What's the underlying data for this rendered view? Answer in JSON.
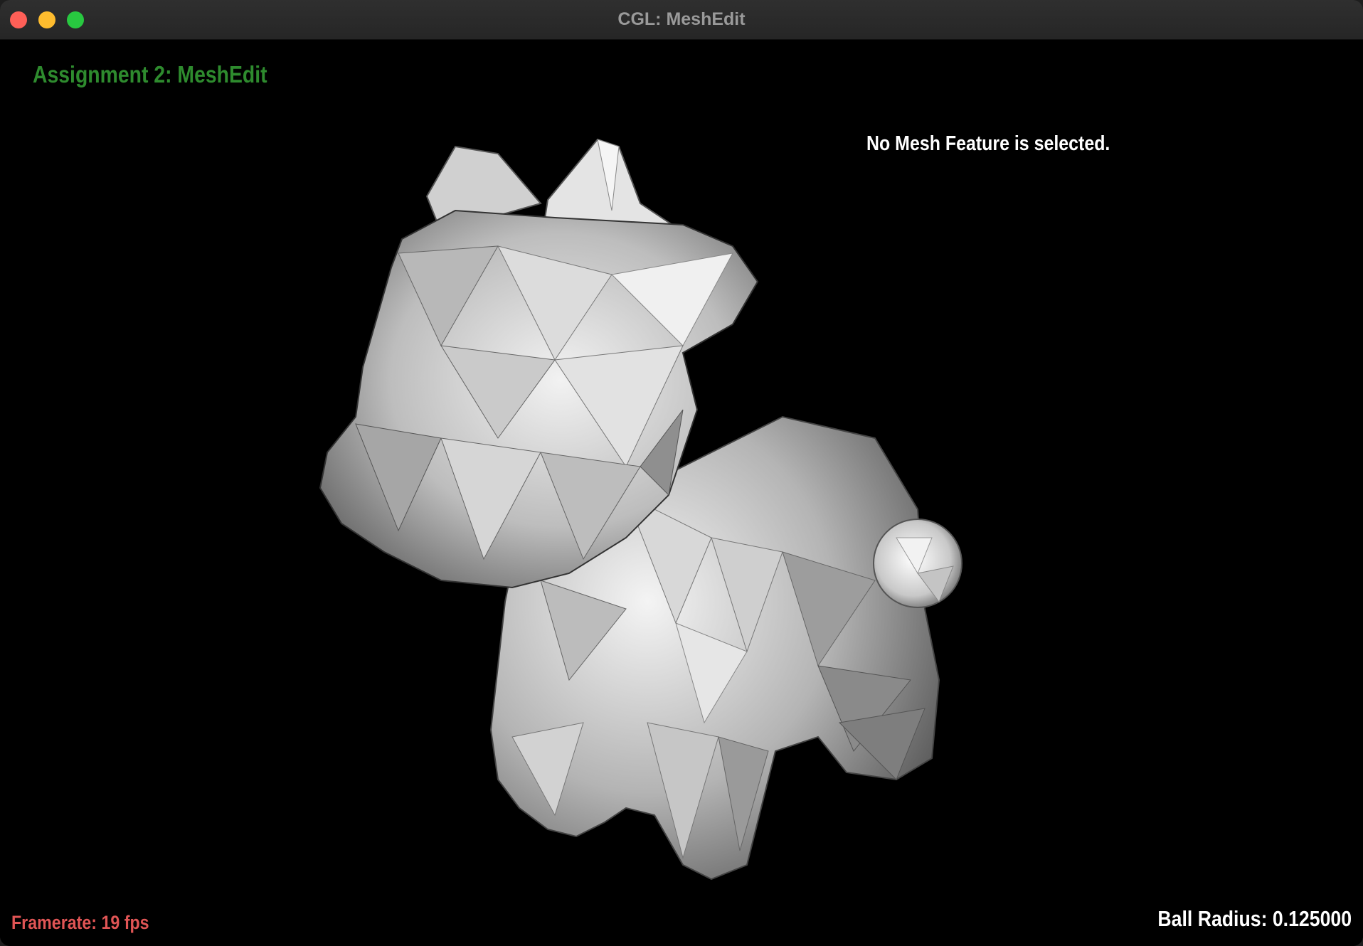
{
  "window": {
    "title": "CGL: MeshEdit"
  },
  "hud": {
    "assignment_title": "Assignment 2: MeshEdit",
    "selection_status": "No Mesh Feature is selected.",
    "framerate": "Framerate: 19 fps",
    "ball_radius": "Ball Radius: 0.125000"
  },
  "colors": {
    "title_green": "#2e8b2e",
    "framerate_red": "#e05555",
    "status_white": "#ffffff",
    "background": "#000000"
  }
}
